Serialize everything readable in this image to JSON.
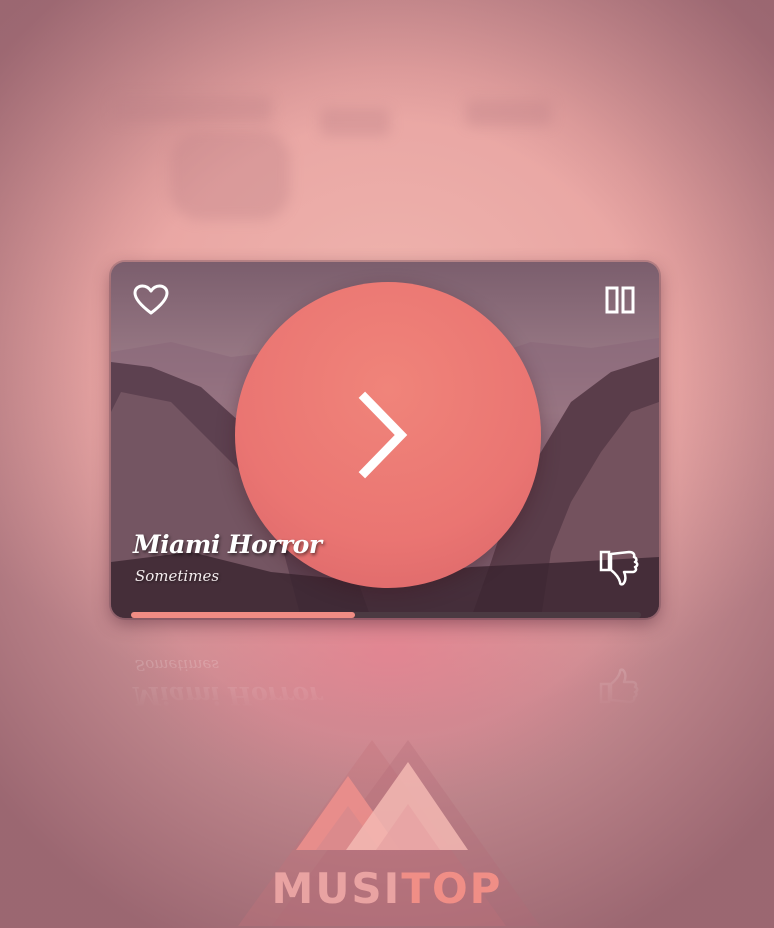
{
  "player": {
    "title": "Miami Horror",
    "subtitle": "Sometimes",
    "progress": 0.44,
    "icons": {
      "like": "heart-icon",
      "pause": "pause-icon",
      "next": "chevron-right-icon",
      "dislike": "thumbs-down-icon"
    }
  },
  "brand": {
    "part1": "MUSI",
    "part2": "TOP"
  },
  "colors": {
    "accent": "#f08c84",
    "circle": "#ea7572",
    "track": "#4b3a42",
    "background": "#e8a4a2"
  }
}
